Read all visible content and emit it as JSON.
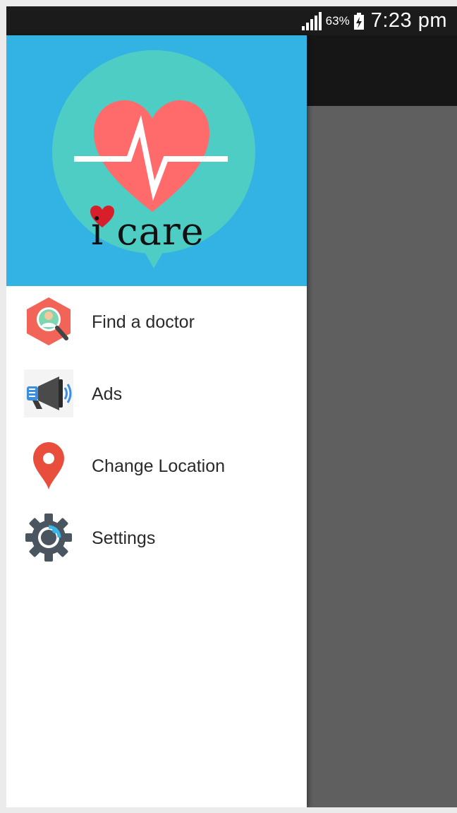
{
  "status_bar": {
    "battery_percent": "63%",
    "time": "7:23 pm"
  },
  "drawer": {
    "logo_text": "i care",
    "header_color": "#32b3e4",
    "items": [
      {
        "label": "Find a doctor",
        "icon": "find-doctor-icon"
      },
      {
        "label": "Ads",
        "icon": "megaphone-icon"
      },
      {
        "label": "Change Location",
        "icon": "location-pin-icon"
      },
      {
        "label": "Settings",
        "icon": "gear-icon"
      }
    ]
  },
  "colors": {
    "scrim": "#5f5f5f",
    "app_bar": "#161616",
    "logo_circle": "#4ecdc4",
    "heart": "#ff6b6b",
    "pin": "#e94e3d"
  }
}
